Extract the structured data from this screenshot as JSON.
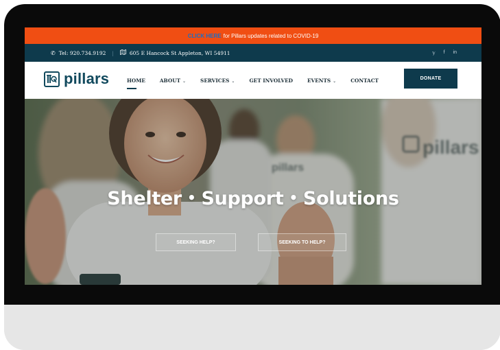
{
  "alert": {
    "link_text": "CLICK HERE",
    "message": "for Pillars updates related to COVID-19"
  },
  "contact": {
    "phone": "Tel: 920.734.9192",
    "separator": "|",
    "address": "605 E Hancock St Appleton, WI 54911",
    "social": [
      "twitter-icon",
      "facebook-icon",
      "linkedin-icon"
    ],
    "social_glyphs": [
      "𝕪",
      "f",
      "in"
    ]
  },
  "brand": {
    "name": "pillars",
    "primary_color": "#0e3a4c",
    "alert_color": "#f04e13"
  },
  "nav": {
    "items": [
      {
        "label": "HOME",
        "active": true,
        "dropdown": false
      },
      {
        "label": "ABOUT",
        "active": false,
        "dropdown": true
      },
      {
        "label": "SERVICES",
        "active": false,
        "dropdown": true
      },
      {
        "label": "GET INVOLVED",
        "active": false,
        "dropdown": false
      },
      {
        "label": "EVENTS",
        "active": false,
        "dropdown": true
      },
      {
        "label": "CONTACT",
        "active": false,
        "dropdown": false
      }
    ],
    "donate_label": "DONATE",
    "chevron": "⌄"
  },
  "hero": {
    "words": [
      "Shelter",
      "Support",
      "Solutions"
    ],
    "dot": "•",
    "button_1": "SEEKING HELP?",
    "button_2": "SEEKING TO HELP?"
  }
}
